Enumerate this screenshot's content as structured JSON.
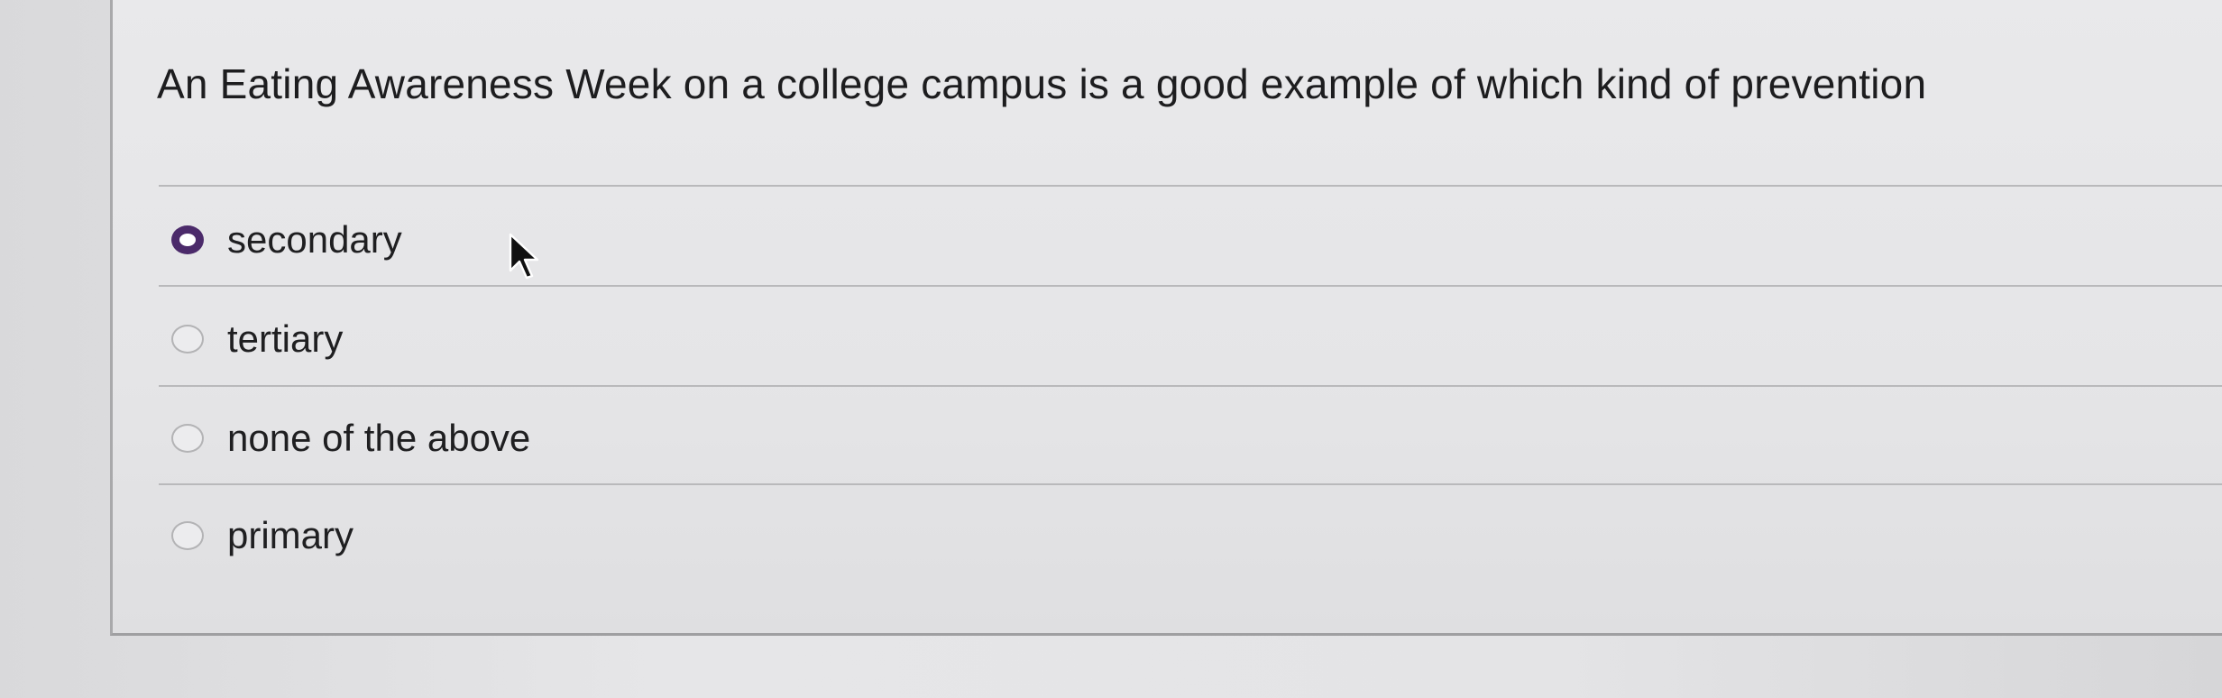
{
  "question": {
    "text": "An Eating Awareness Week on a college campus is a good example of which kind of prevention"
  },
  "options": [
    {
      "label": "secondary",
      "selected": true
    },
    {
      "label": "tertiary",
      "selected": false
    },
    {
      "label": "none of the above",
      "selected": false
    },
    {
      "label": "primary",
      "selected": false
    }
  ],
  "colors": {
    "selected_radio": "#4b2a6a",
    "text": "#1d1d1f"
  }
}
